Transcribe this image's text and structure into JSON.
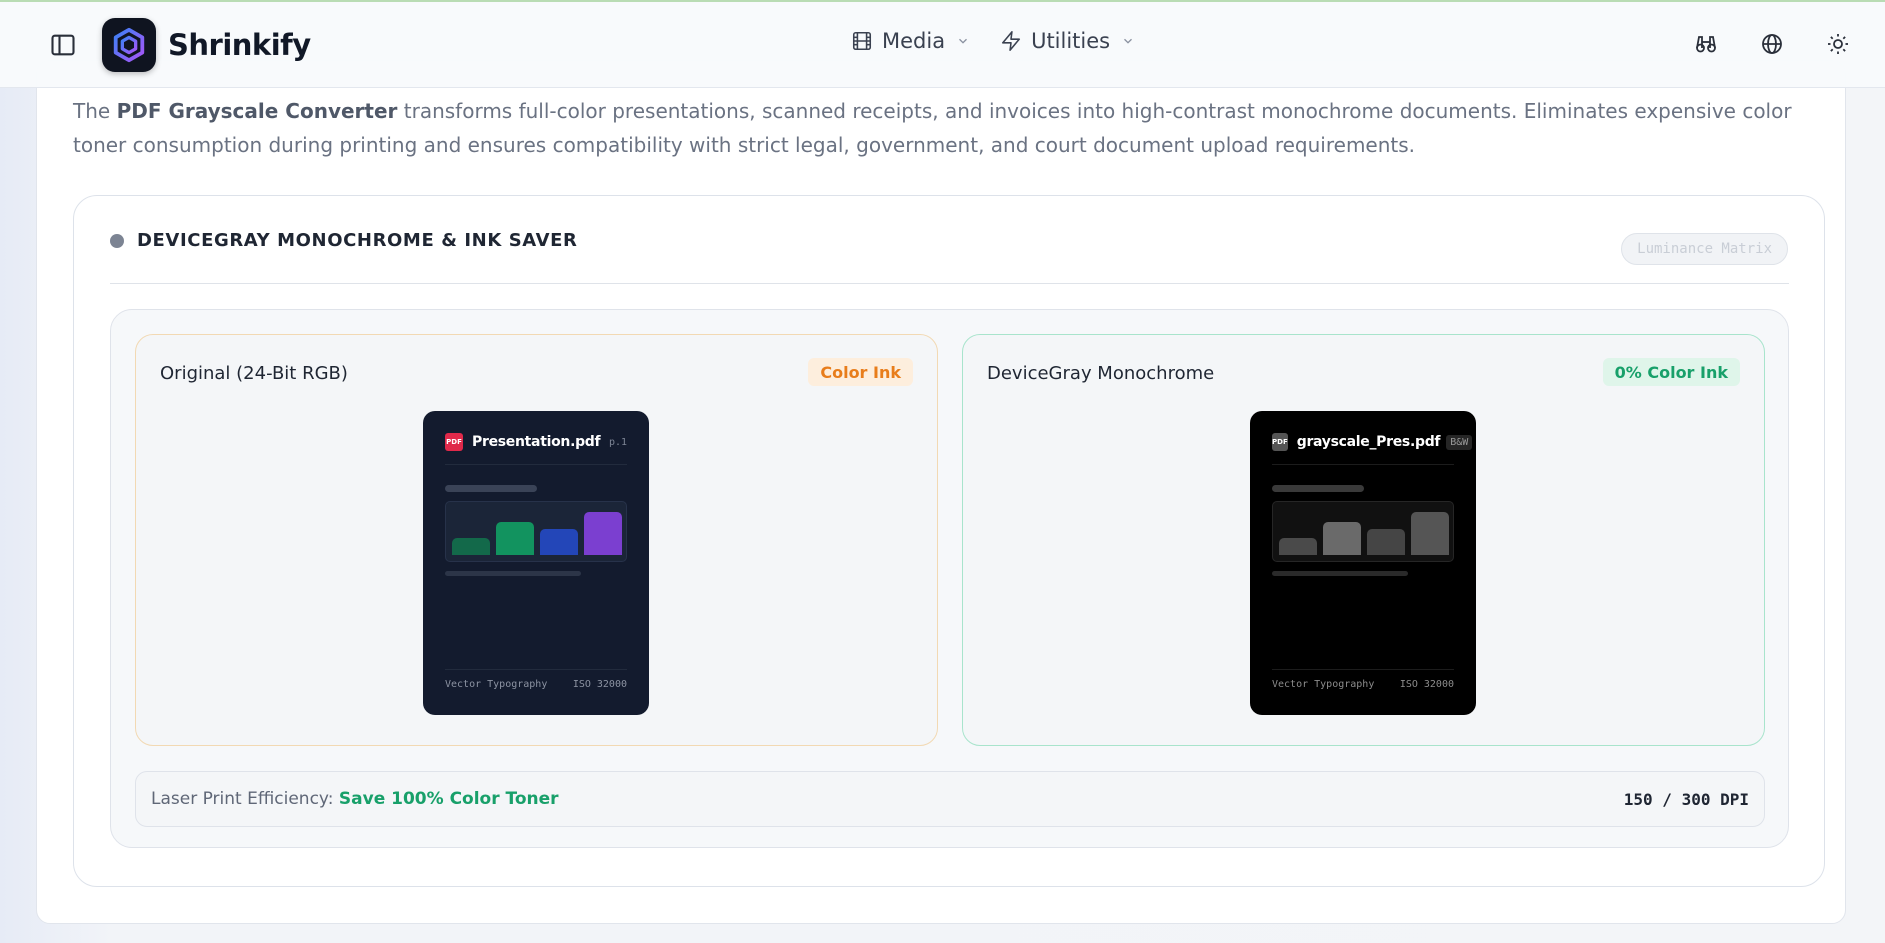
{
  "header": {
    "brand": "Shrinkify",
    "nav": [
      {
        "label": "Media",
        "icon": "film-icon"
      },
      {
        "label": "Utilities",
        "icon": "lightning-icon"
      }
    ],
    "right_icons": [
      "binoculars-icon",
      "globe-icon",
      "sun-icon"
    ]
  },
  "intro": {
    "prefix": "The ",
    "bold": "PDF Grayscale Converter",
    "rest": " transforms full-color presentations, scanned receipts, and invoices into high-contrast monochrome documents. Eliminates expensive color toner consumption during printing and ensures compatibility with strict legal, government, and court document upload requirements."
  },
  "tool": {
    "title": "DEVICEGRAY MONOCHROME & INK SAVER",
    "badge": "Luminance Matrix",
    "left_panel": {
      "title": "Original (24-Bit RGB)",
      "badge": "Color Ink",
      "doc": {
        "icon_label": "PDF",
        "name": "Presentation.pdf",
        "tag": "p.1",
        "footer_left": "Vector Typography",
        "footer_right": "ISO 32000",
        "mark_colors": [
          "#13694a",
          "#12935f",
          "#2346b8",
          "#7b3fd0"
        ]
      }
    },
    "right_panel": {
      "title": "DeviceGray Monochrome",
      "badge": "0% Color Ink",
      "doc": {
        "icon_label": "PDF",
        "name": "grayscale_Pres.pdf",
        "tag": "B&W",
        "footer_left": "Vector Typography",
        "footer_right": "ISO 32000",
        "mark_colors": [
          "#4a4a4a",
          "#6a6a6a",
          "#454545",
          "#555555"
        ]
      }
    },
    "efficiency": {
      "label": "Laser Print Efficiency: ",
      "value": "Save 100% Color Toner",
      "dpi": "150 / 300 DPI"
    }
  },
  "colors": {
    "accent_orange": "#e87d1b",
    "accent_green": "#18a06a",
    "doc_color_bg": "#131b2e",
    "doc_gray_bg": "#000000"
  }
}
